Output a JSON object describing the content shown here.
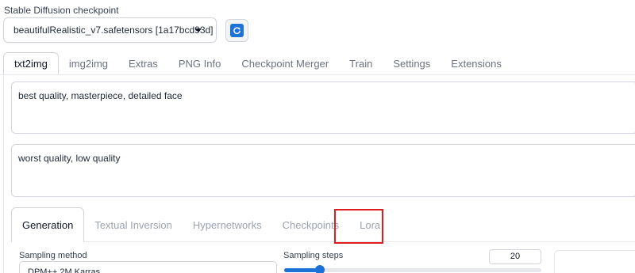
{
  "checkpoint": {
    "label": "Stable Diffusion checkpoint",
    "value": "beautifulRealistic_v7.safetensors [1a17bcd93d]",
    "refresh_icon": "refresh-icon"
  },
  "tabs": [
    {
      "label": "txt2img",
      "active": true
    },
    {
      "label": "img2img"
    },
    {
      "label": "Extras"
    },
    {
      "label": "PNG Info"
    },
    {
      "label": "Checkpoint Merger"
    },
    {
      "label": "Train"
    },
    {
      "label": "Settings"
    },
    {
      "label": "Extensions"
    }
  ],
  "prompt": {
    "positive": "best quality, masterpiece, detailed face",
    "negative": "worst quality, low quality"
  },
  "subtabs": [
    {
      "label": "Generation",
      "active": true
    },
    {
      "label": "Textual Inversion"
    },
    {
      "label": "Hypernetworks"
    },
    {
      "label": "Checkpoints"
    },
    {
      "label": "Lora",
      "highlighted": true
    }
  ],
  "sampling": {
    "method_label": "Sampling method",
    "method_value": "DPM++ 2M Karras",
    "steps_label": "Sampling steps",
    "steps_value": "20",
    "steps_fraction": 0.14
  },
  "colors": {
    "accent": "#1d72d8",
    "highlight": "#e11d1d"
  }
}
